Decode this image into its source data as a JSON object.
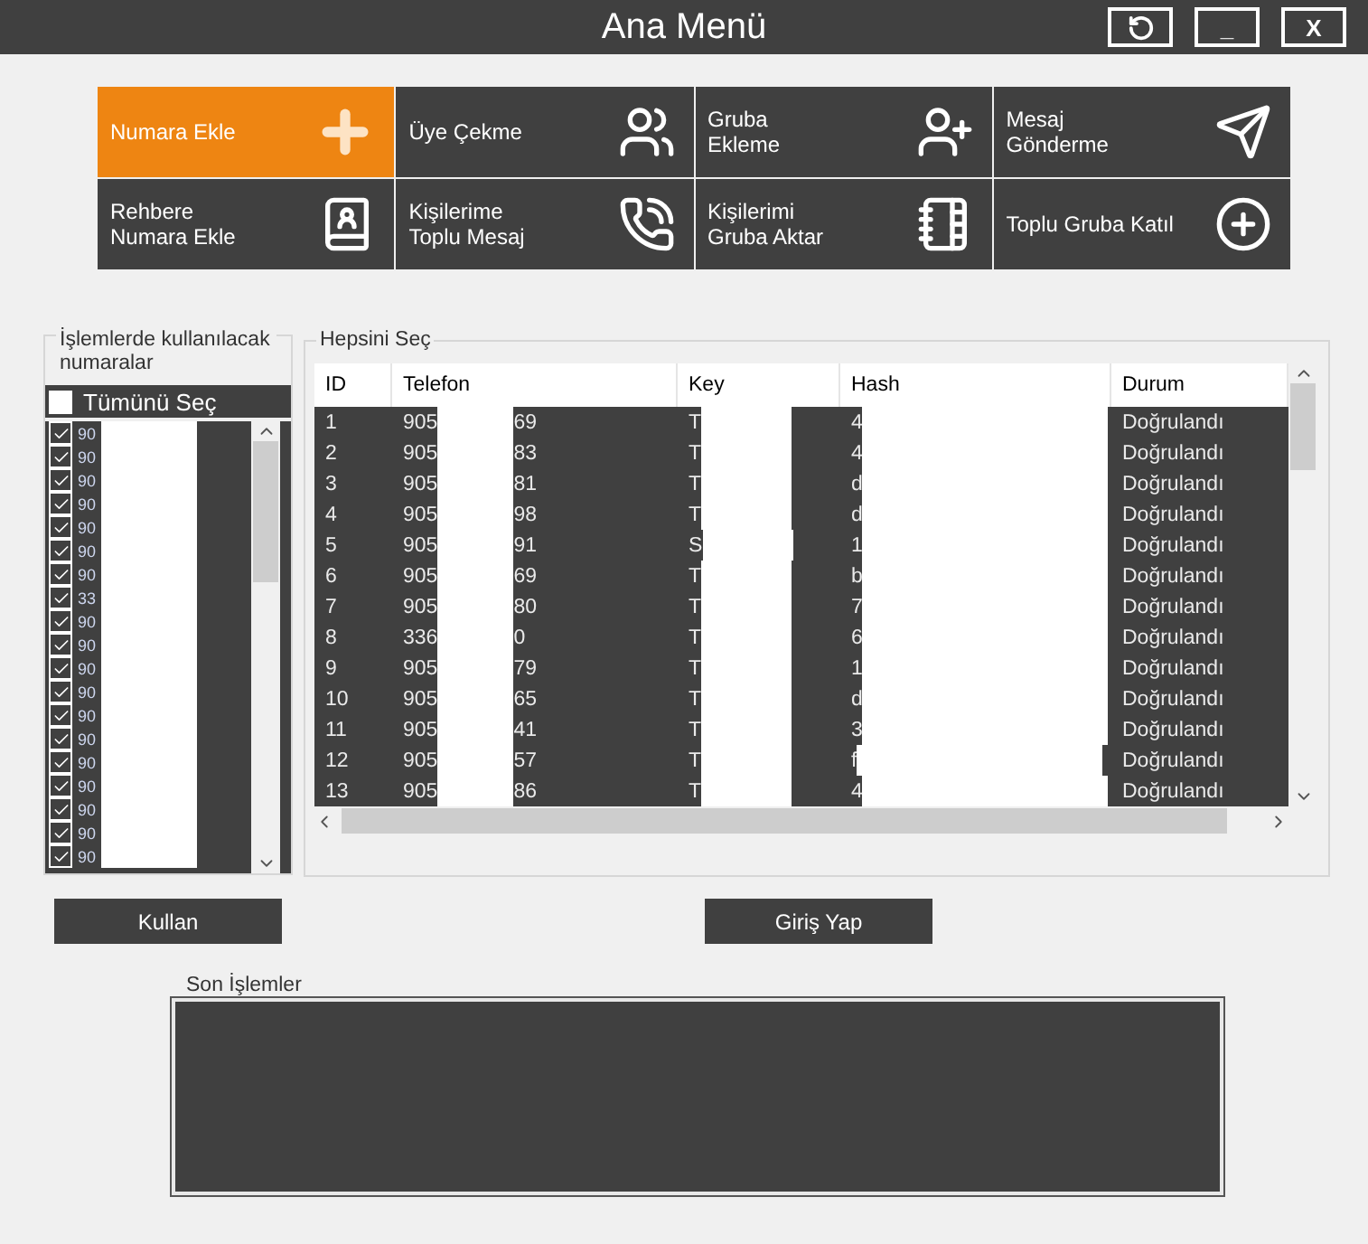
{
  "window": {
    "title": "Ana Menü",
    "buttons": [
      {
        "kind": "refresh"
      },
      {
        "kind": "text",
        "label": "_"
      },
      {
        "kind": "text",
        "label": "X"
      }
    ]
  },
  "tiles": [
    {
      "label": "Numara Ekle",
      "selected": true
    },
    {
      "label": "Üye Çekme",
      "selected": false
    },
    {
      "label": "Gruba\nEkleme",
      "selected": false
    },
    {
      "label": "Mesaj\nGönderme",
      "selected": false
    },
    {
      "label": "Rehbere\nNumara Ekle",
      "selected": false
    },
    {
      "label": "Kişilerime\nToplu Mesaj",
      "selected": false
    },
    {
      "label": "Kişilerimi\nGruba Aktar",
      "selected": false
    },
    {
      "label": "Toplu Gruba Katıl",
      "selected": false
    }
  ],
  "numbers_panel": {
    "title": "İşlemlerde kullanılacak numaralar",
    "select_all": {
      "label": "Tümünü Seç",
      "checked": false
    },
    "items": [
      {
        "text": "90",
        "checked": true
      },
      {
        "text": "90",
        "checked": true
      },
      {
        "text": "90",
        "checked": true
      },
      {
        "text": "90",
        "checked": true
      },
      {
        "text": "90",
        "checked": true
      },
      {
        "text": "90",
        "checked": true
      },
      {
        "text": "90",
        "checked": true
      },
      {
        "text": "33",
        "checked": true
      },
      {
        "text": "90",
        "checked": true
      },
      {
        "text": "90",
        "checked": true
      },
      {
        "text": "90",
        "checked": true
      },
      {
        "text": "90",
        "checked": true
      },
      {
        "text": "90",
        "checked": true
      },
      {
        "text": "90",
        "checked": true
      },
      {
        "text": "90",
        "checked": true
      },
      {
        "text": "90",
        "checked": true
      },
      {
        "text": "90",
        "checked": true
      },
      {
        "text": "90",
        "checked": true
      },
      {
        "text": "90",
        "checked": true
      }
    ]
  },
  "table_panel": {
    "title": "Hepsini Seç",
    "columns": [
      "ID",
      "Telefon",
      "Key",
      "Hash",
      "Durum"
    ],
    "rows": [
      {
        "id": "1",
        "phone_start": "905",
        "phone_end": "69",
        "key": "T",
        "hash": "4",
        "status": "Doğrulandı"
      },
      {
        "id": "2",
        "phone_start": "905",
        "phone_end": "83",
        "key": "T",
        "hash": "4",
        "status": "Doğrulandı"
      },
      {
        "id": "3",
        "phone_start": "905",
        "phone_end": "81",
        "key": "T",
        "hash": "d",
        "status": "Doğrulandı"
      },
      {
        "id": "4",
        "phone_start": "905",
        "phone_end": "98",
        "key": "T",
        "hash": "d",
        "status": "Doğrulandı"
      },
      {
        "id": "5",
        "phone_start": "905",
        "phone_end": "91",
        "key": "S",
        "hash": "1",
        "status": "Doğrulandı"
      },
      {
        "id": "6",
        "phone_start": "905",
        "phone_end": "69",
        "key": "T",
        "hash": "b",
        "status": "Doğrulandı"
      },
      {
        "id": "7",
        "phone_start": "905",
        "phone_end": "80",
        "key": "T",
        "hash": "7",
        "status": "Doğrulandı"
      },
      {
        "id": "8",
        "phone_start": "336",
        "phone_end": "0",
        "key": "T",
        "hash": "6",
        "status": "Doğrulandı"
      },
      {
        "id": "9",
        "phone_start": "905",
        "phone_end": "79",
        "key": "T",
        "hash": "1",
        "status": "Doğrulandı"
      },
      {
        "id": "10",
        "phone_start": "905",
        "phone_end": "65",
        "key": "T",
        "hash": "d",
        "status": "Doğrulandı"
      },
      {
        "id": "11",
        "phone_start": "905",
        "phone_end": "41",
        "key": "T",
        "hash": "3",
        "status": "Doğrulandı"
      },
      {
        "id": "12",
        "phone_start": "905",
        "phone_end": "57",
        "key": "T",
        "hash": "f",
        "status": "Doğrulandı"
      },
      {
        "id": "13",
        "phone_start": "905",
        "phone_end": "86",
        "key": "T",
        "hash": "4",
        "status": "Doğrulandı"
      }
    ]
  },
  "actions": {
    "use_button": "Kullan",
    "login_button": "Giriş Yap"
  },
  "log": {
    "title": "Son İşlemler"
  }
}
